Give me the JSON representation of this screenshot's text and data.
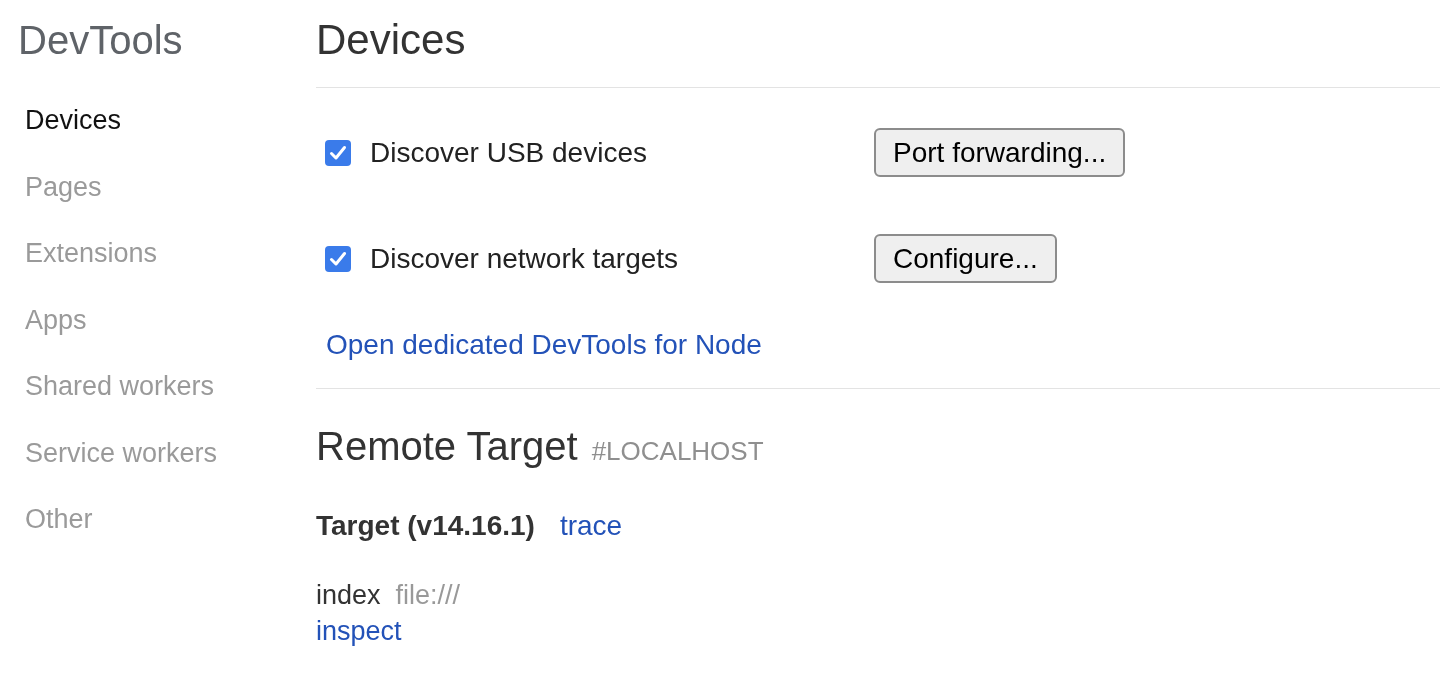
{
  "sidebar": {
    "title": "DevTools",
    "items": [
      {
        "label": "Devices",
        "selected": true
      },
      {
        "label": "Pages",
        "selected": false
      },
      {
        "label": "Extensions",
        "selected": false
      },
      {
        "label": "Apps",
        "selected": false
      },
      {
        "label": "Shared workers",
        "selected": false
      },
      {
        "label": "Service workers",
        "selected": false
      },
      {
        "label": "Other",
        "selected": false
      }
    ]
  },
  "main": {
    "title": "Devices",
    "options": [
      {
        "label": "Discover USB devices",
        "checked": true,
        "button": "Port forwarding..."
      },
      {
        "label": "Discover network targets",
        "checked": true,
        "button": "Configure..."
      }
    ],
    "node_link": "Open dedicated DevTools for Node",
    "remote_target": {
      "title": "Remote Target",
      "host": "#LOCALHOST",
      "targets": [
        {
          "name": "Target (v14.16.1)",
          "action": "trace",
          "pages": [
            {
              "name": "index",
              "url": "file:///",
              "actions": [
                "inspect"
              ]
            }
          ]
        }
      ]
    }
  }
}
